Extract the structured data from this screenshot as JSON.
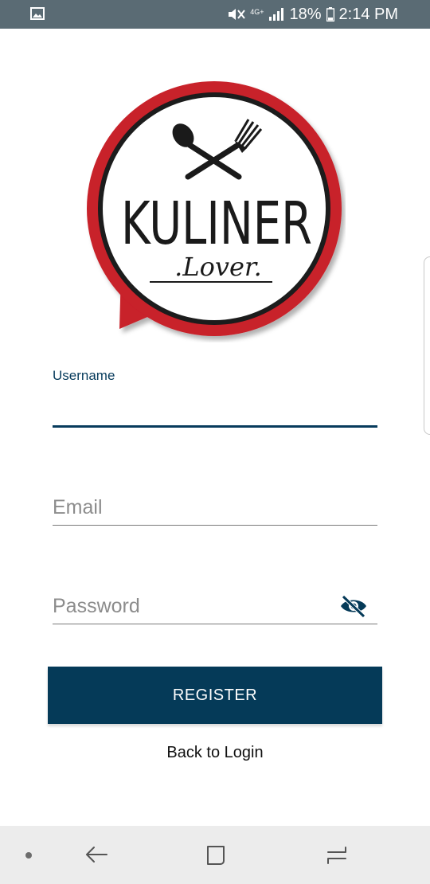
{
  "status_bar": {
    "network": "4G+",
    "battery": "18%",
    "time": "2:14 PM",
    "icons": [
      "gallery-icon",
      "mute-icon",
      "signal-icon",
      "battery-icon"
    ]
  },
  "logo": {
    "title": "KULINER",
    "subtitle": ".Lover.",
    "colors": {
      "ring": "#c8202a",
      "inner_ring": "#1a1a1a"
    }
  },
  "form": {
    "username_label": "Username",
    "username_value": "",
    "email_placeholder": "Email",
    "email_value": "",
    "password_placeholder": "Password",
    "password_value": "",
    "password_toggle_icon": "eye-off-icon"
  },
  "actions": {
    "register_label": "REGISTER",
    "back_label": "Back to Login"
  },
  "colors": {
    "primary": "#053a58",
    "status_bar": "#5a6b74",
    "nav_bar": "#ececec"
  }
}
